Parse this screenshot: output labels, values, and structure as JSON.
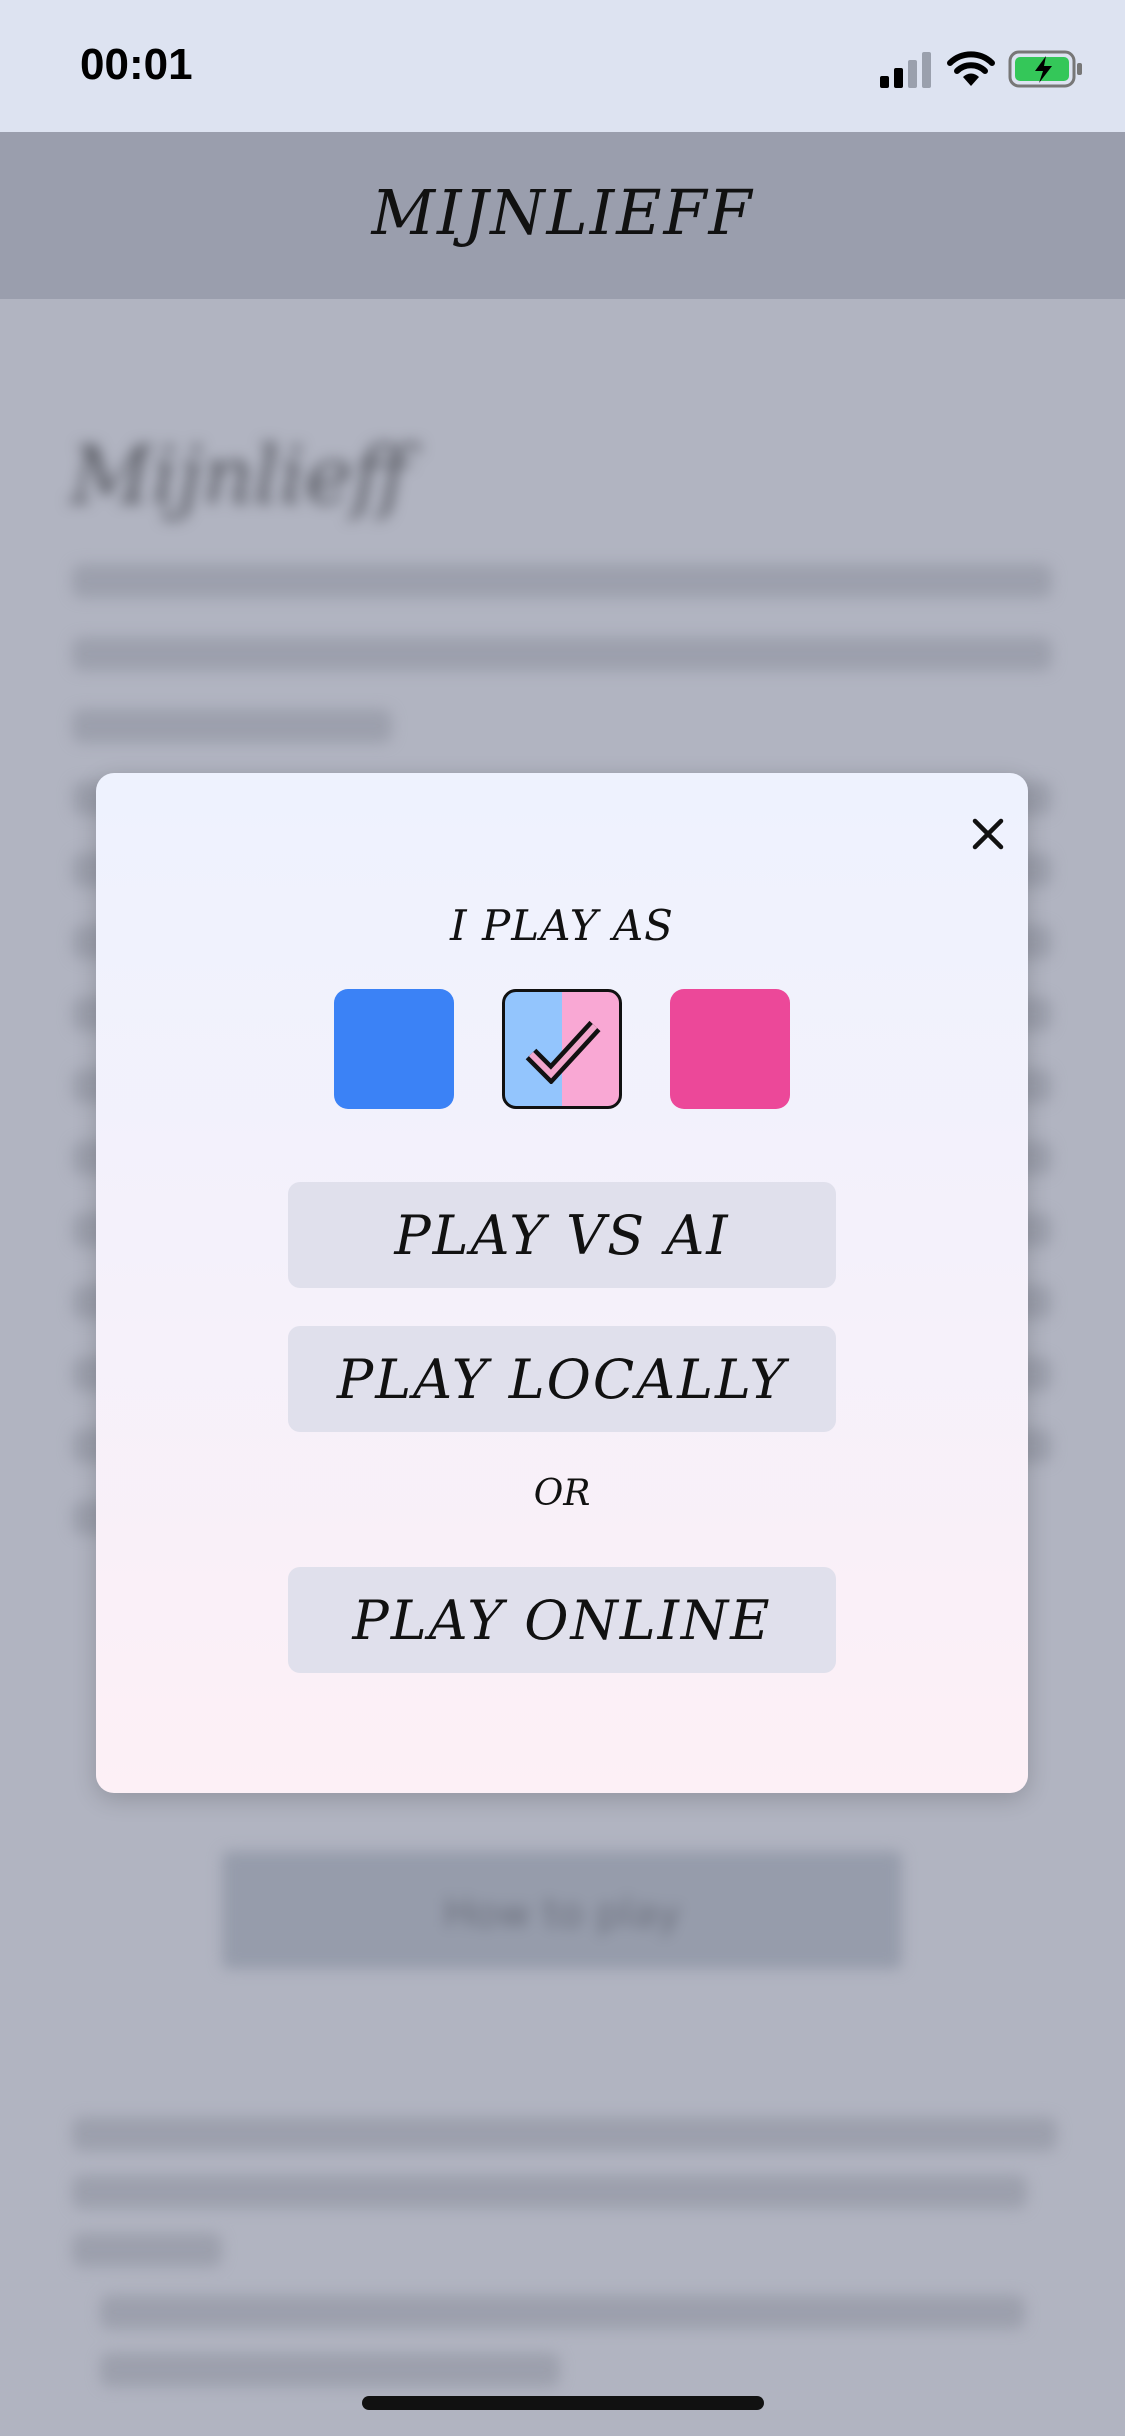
{
  "status_bar": {
    "time": "00:01",
    "icons": [
      "cellular-signal-icon",
      "wifi-icon",
      "battery-charging-icon"
    ]
  },
  "header": {
    "title": "MIJNLIEFF"
  },
  "background_page": {
    "heading": "Mijnlieff",
    "help_button": "How to play"
  },
  "modal": {
    "close_icon": "close-icon",
    "play_as_label": "I PLAY AS",
    "color_options": [
      {
        "name": "blue",
        "color": "#3b82f6",
        "selected": false
      },
      {
        "name": "both",
        "colors": [
          "#93c5fd",
          "#f9a8d4"
        ],
        "selected": true
      },
      {
        "name": "pink",
        "color": "#ec4899",
        "selected": false
      }
    ],
    "play_vs_ai": "PLAY VS AI",
    "play_locally": "PLAY LOCALLY",
    "or_label": "OR",
    "play_online": "PLAY ONLINE"
  },
  "colors": {
    "status_bar_bg": "#dde3f1",
    "header_bg": "#9a9ead",
    "button_bg": "#e0e0ec",
    "battery_green": "#34c759"
  }
}
